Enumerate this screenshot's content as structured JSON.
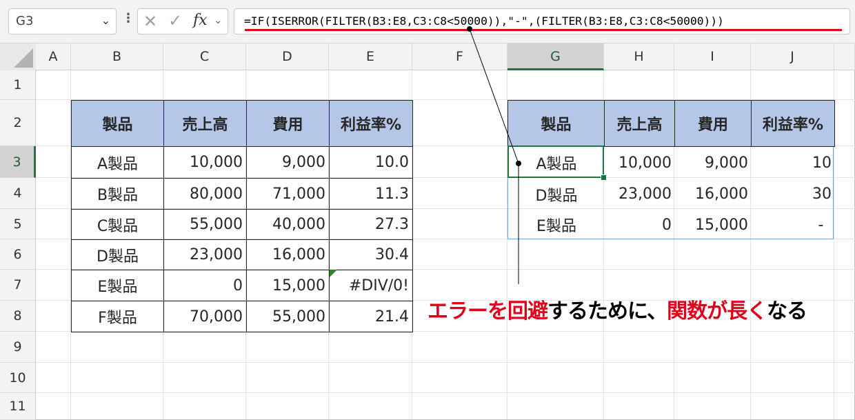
{
  "formula_bar": {
    "name_box": "G3",
    "formula": "=IF(ISERROR(FILTER(B3:E8,C3:C8<50000)),\"-\",(FILTER(B3:E8,C3:C8<50000)))",
    "fx_label": "fx"
  },
  "columns": [
    "A",
    "B",
    "C",
    "D",
    "E",
    "F",
    "G",
    "H",
    "I",
    "J"
  ],
  "rows": [
    "1",
    "2",
    "3",
    "4",
    "5",
    "6",
    "7",
    "8",
    "9",
    "10",
    "11"
  ],
  "selected_column": "G",
  "selected_row": "3",
  "left_table": {
    "headers": [
      "製品",
      "売上高",
      "費用",
      "利益率%"
    ],
    "rows": [
      [
        "A製品",
        "10,000",
        "9,000",
        "10.0"
      ],
      [
        "B製品",
        "80,000",
        "71,000",
        "11.3"
      ],
      [
        "C製品",
        "55,000",
        "40,000",
        "27.3"
      ],
      [
        "D製品",
        "23,000",
        "16,000",
        "30.4"
      ],
      [
        "E製品",
        "0",
        "15,000",
        "#DIV/0!"
      ],
      [
        "F製品",
        "70,000",
        "55,000",
        "21.4"
      ]
    ]
  },
  "right_table": {
    "headers": [
      "製品",
      "売上高",
      "費用",
      "利益率%"
    ],
    "rows": [
      [
        "A製品",
        "10,000",
        "9,000",
        "10"
      ],
      [
        "D製品",
        "23,000",
        "16,000",
        "30"
      ],
      [
        "E製品",
        "0",
        "15,000",
        "-"
      ]
    ]
  },
  "callout": {
    "parts": [
      {
        "text": "エラーを回避",
        "color": "red"
      },
      {
        "text": "するために、",
        "color": "black"
      },
      {
        "text": "関数が長く",
        "color": "red"
      },
      {
        "text": "なる",
        "color": "black"
      }
    ]
  },
  "colors": {
    "header_fill": "#b4c7e7",
    "excel_green": "#217346",
    "accent_red": "#e0001a"
  }
}
